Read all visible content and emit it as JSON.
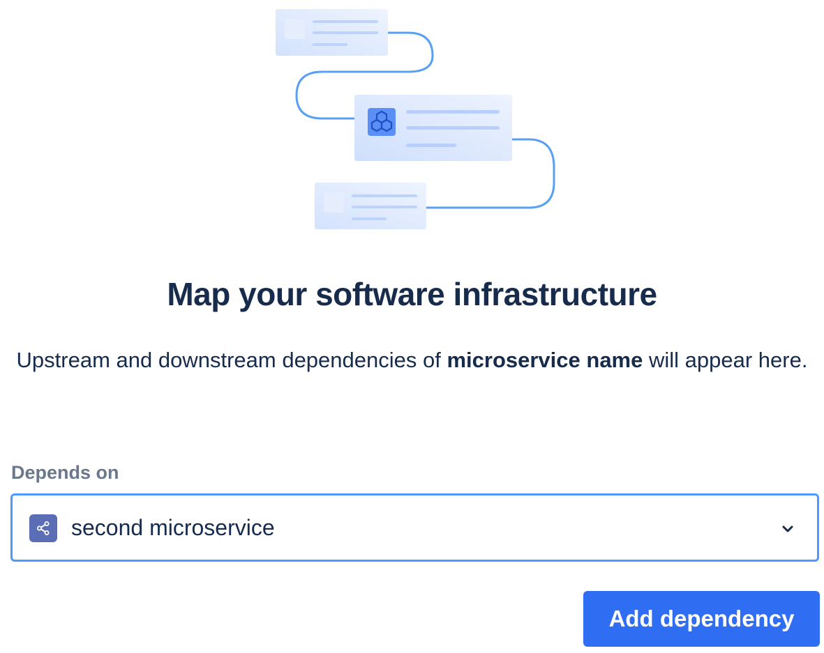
{
  "illustration": {
    "icon": "hexagon-cluster-icon",
    "accent_color": "#5aa0f2"
  },
  "empty_state": {
    "title": "Map your software infrastructure",
    "description_prefix": "Upstream and downstream dependencies of ",
    "description_bold": "microservice name",
    "description_suffix": " will appear here."
  },
  "dependency_field": {
    "label": "Depends on",
    "selected_value": "second microservice",
    "selected_icon": "share-nodes-icon",
    "dropdown_icon": "chevron-down-icon",
    "border_color": "#4c9aff"
  },
  "actions": {
    "add_label": "Add dependency",
    "add_color": "#2f6ef2"
  }
}
